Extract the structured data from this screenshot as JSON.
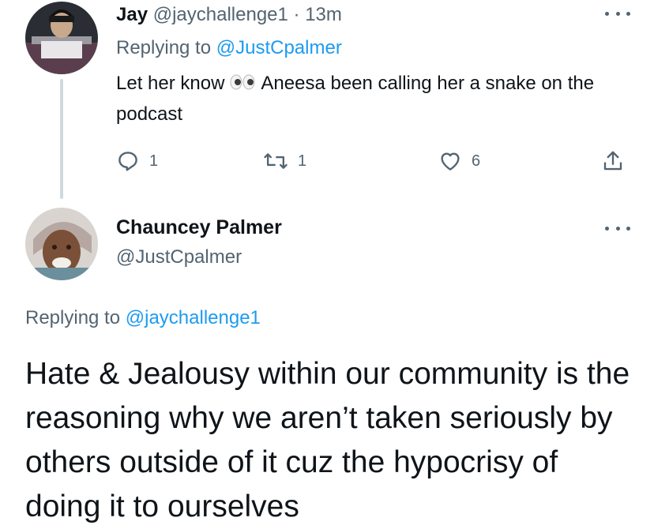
{
  "reply_tweet": {
    "author_name": "Jay",
    "handle": "@jaychallenge1",
    "separator": "·",
    "time": "13m",
    "replying_prefix": "Replying to",
    "replying_to": "@JustCpalmer",
    "text_before": "Let her know",
    "text_after": "Aneesa been calling her a snake on the podcast",
    "emoji_icon": "eyes-icon",
    "reply_count": "1",
    "retweet_count": "1",
    "like_count": "6"
  },
  "main_tweet": {
    "author_name": "Chauncey Palmer",
    "handle": "@JustCpalmer",
    "replying_prefix": "Replying to",
    "replying_to": "@jaychallenge1",
    "text": "Hate & Jealousy within our community is the reasoning why we aren’t taken seriously by others outside of it cuz the hypocrisy of doing it to ourselves"
  },
  "colors": {
    "text": "#0f1419",
    "muted": "#536471",
    "link": "#1d9bf0",
    "thread_line": "#cfd9de"
  }
}
